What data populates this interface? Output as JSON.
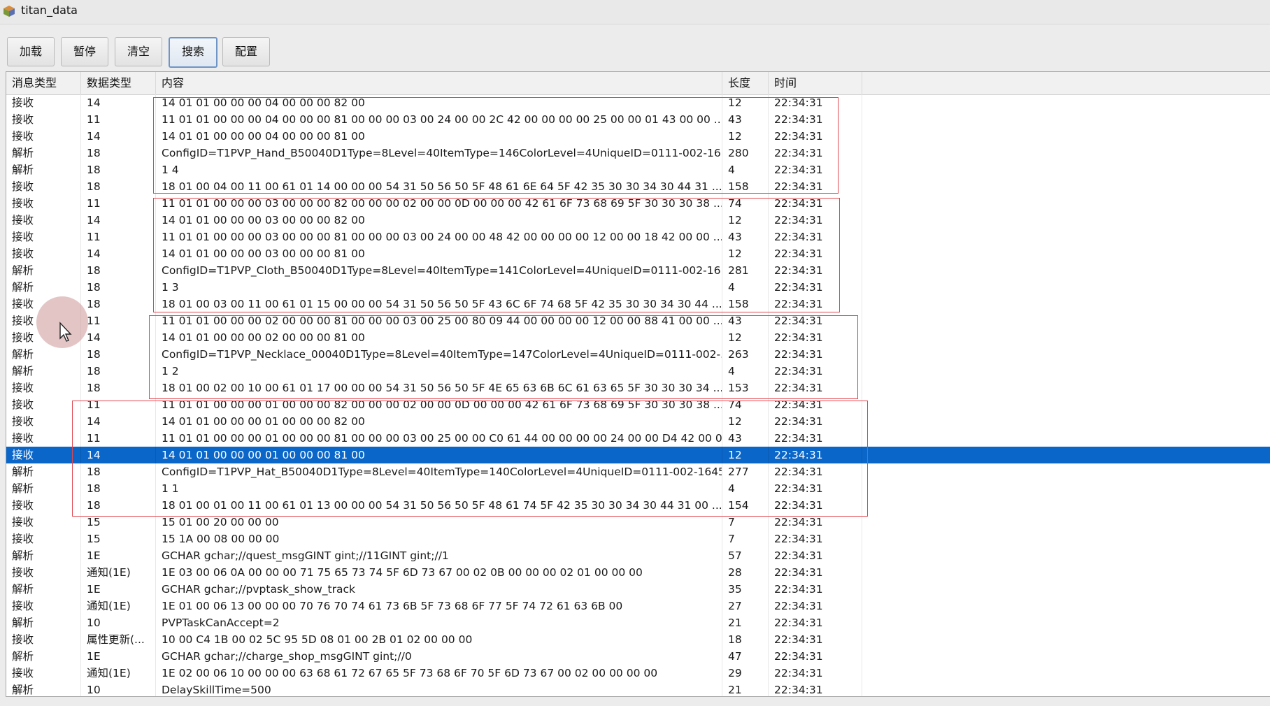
{
  "window": {
    "title": "titan_data",
    "icon": "app-cube-icon"
  },
  "toolbar": {
    "load": "加载",
    "pause": "暂停",
    "clear": "清空",
    "search": "搜索",
    "config": "配置"
  },
  "table": {
    "columns": [
      "消息类型",
      "数据类型",
      "内容",
      "长度",
      "时间"
    ],
    "selected_row_index": 21,
    "rows": [
      [
        "接收",
        "14",
        "14 01 01 00 00 00 04 00 00 00 82 00",
        "12",
        "22:34:31"
      ],
      [
        "接收",
        "11",
        "11 01 01 00 00 00 04 00 00 00 81 00 00 00 03 00 24 00 00 2C 42 00 00 00 00 25 00 00 01 43 00 00 ...",
        "43",
        "22:34:31"
      ],
      [
        "接收",
        "14",
        "14 01 01 00 00 00 04 00 00 00 81 00",
        "12",
        "22:34:31"
      ],
      [
        "解析",
        "18",
        "ConfigID=T1PVP_Hand_B50040D1Type=8Level=40ItemType=146ColorLevel=4UniqueID=0111-002-16...",
        "280",
        "22:34:31"
      ],
      [
        "解析",
        "18",
        "1 4",
        "4",
        "22:34:31"
      ],
      [
        "接收",
        "18",
        "18 01 00 04 00 11 00 61 01 14 00 00 00 54 31 50 56 50 5F 48 61 6E 64 5F 42 35 30 30 34 30 44 31 ...",
        "158",
        "22:34:31"
      ],
      [
        "接收",
        "11",
        "11 01 01 00 00 00 03 00 00 00 82 00 00 00 02 00 00 0D 00 00 00 42 61 6F 73 68 69 5F 30 30 30 38 ...",
        "74",
        "22:34:31"
      ],
      [
        "接收",
        "14",
        "14 01 01 00 00 00 03 00 00 00 82 00",
        "12",
        "22:34:31"
      ],
      [
        "接收",
        "11",
        "11 01 01 00 00 00 03 00 00 00 81 00 00 00 03 00 24 00 00 48 42 00 00 00 00 12 00 00 18 42 00 00 ...",
        "43",
        "22:34:31"
      ],
      [
        "接收",
        "14",
        "14 01 01 00 00 00 03 00 00 00 81 00",
        "12",
        "22:34:31"
      ],
      [
        "解析",
        "18",
        "ConfigID=T1PVP_Cloth_B50040D1Type=8Level=40ItemType=141ColorLevel=4UniqueID=0111-002-16...",
        "281",
        "22:34:31"
      ],
      [
        "解析",
        "18",
        "1 3",
        "4",
        "22:34:31"
      ],
      [
        "接收",
        "18",
        "18 01 00 03 00 11 00 61 01 15 00 00 00 54 31 50 56 50 5F 43 6C 6F 74 68 5F 42 35 30 30 34 30 44 ...",
        "158",
        "22:34:31"
      ],
      [
        "接收",
        "11",
        "11 01 01 00 00 00 02 00 00 00 81 00 00 00 03 00 25 00 80 09 44 00 00 00 00 12 00 00 88 41 00 00 ...",
        "43",
        "22:34:31"
      ],
      [
        "接收",
        "14",
        "14 01 01 00 00 00 02 00 00 00 81 00",
        "12",
        "22:34:31"
      ],
      [
        "解析",
        "18",
        "ConfigID=T1PVP_Necklace_00040D1Type=8Level=40ItemType=147ColorLevel=4UniqueID=0111-002-...",
        "263",
        "22:34:31"
      ],
      [
        "解析",
        "18",
        "1 2",
        "4",
        "22:34:31"
      ],
      [
        "接收",
        "18",
        "18 01 00 02 00 10 00 61 01 17 00 00 00 54 31 50 56 50 5F 4E 65 63 6B 6C 61 63 65 5F 30 30 30 34 ...",
        "153",
        "22:34:31"
      ],
      [
        "接收",
        "11",
        "11 01 01 00 00 00 01 00 00 00 82 00 00 00 02 00 00 0D 00 00 00 42 61 6F 73 68 69 5F 30 30 30 38 ...",
        "74",
        "22:34:31"
      ],
      [
        "接收",
        "14",
        "14 01 01 00 00 00 01 00 00 00 82 00",
        "12",
        "22:34:31"
      ],
      [
        "接收",
        "11",
        "11 01 01 00 00 00 01 00 00 00 81 00 00 00 03 00 25 00 00 C0 61 44 00 00 00 00 24 00 00 D4 42 00 00...",
        "43",
        "22:34:31"
      ],
      [
        "接收",
        "14",
        "14 01 01 00 00 00 01 00 00 00 81 00",
        "12",
        "22:34:31"
      ],
      [
        "解析",
        "18",
        "ConfigID=T1PVP_Hat_B50040D1Type=8Level=40ItemType=140ColorLevel=4UniqueID=0111-002-1645...",
        "277",
        "22:34:31"
      ],
      [
        "解析",
        "18",
        "1 1",
        "4",
        "22:34:31"
      ],
      [
        "接收",
        "18",
        "18 01 00 01 00 11 00 61 01 13 00 00 00 54 31 50 56 50 5F 48 61 74 5F 42 35 30 30 34 30 44 31 00 ...",
        "154",
        "22:34:31"
      ],
      [
        "接收",
        "15",
        "15 01 00 20 00 00 00",
        "7",
        "22:34:31"
      ],
      [
        "接收",
        "15",
        "15 1A 00 08 00 00 00",
        "7",
        "22:34:31"
      ],
      [
        "解析",
        "1E",
        "GCHAR gchar;//quest_msgGINT gint;//11GINT gint;//1",
        "57",
        "22:34:31"
      ],
      [
        "接收",
        "通知(1E)",
        "1E 03 00 06 0A 00 00 00 71 75 65 73 74 5F 6D 73 67 00 02 0B 00 00 00 02 01 00 00 00",
        "28",
        "22:34:31"
      ],
      [
        "解析",
        "1E",
        "GCHAR gchar;//pvptask_show_track",
        "35",
        "22:34:31"
      ],
      [
        "接收",
        "通知(1E)",
        "1E 01 00 06 13 00 00 00 70 76 70 74 61 73 6B 5F 73 68 6F 77 5F 74 72 61 63 6B 00",
        "27",
        "22:34:31"
      ],
      [
        "解析",
        "10",
        "PVPTaskCanAccept=2",
        "21",
        "22:34:31"
      ],
      [
        "接收",
        "属性更新(...",
        "10 00 C4 1B 00 02 5C 95 5D 08 01 00 2B 01 02 00 00 00",
        "18",
        "22:34:31"
      ],
      [
        "解析",
        "1E",
        "GCHAR gchar;//charge_shop_msgGINT gint;//0",
        "47",
        "22:34:31"
      ],
      [
        "接收",
        "通知(1E)",
        "1E 02 00 06 10 00 00 00 63 68 61 72 67 65 5F 73 68 6F 70 5F 6D 73 67 00 02 00 00 00 00",
        "29",
        "22:34:31"
      ],
      [
        "解析",
        "10",
        "DelaySkillTime=500",
        "21",
        "22:34:31"
      ]
    ]
  },
  "highlight_color": "#e0474f",
  "selection_color": "#0a66c8"
}
